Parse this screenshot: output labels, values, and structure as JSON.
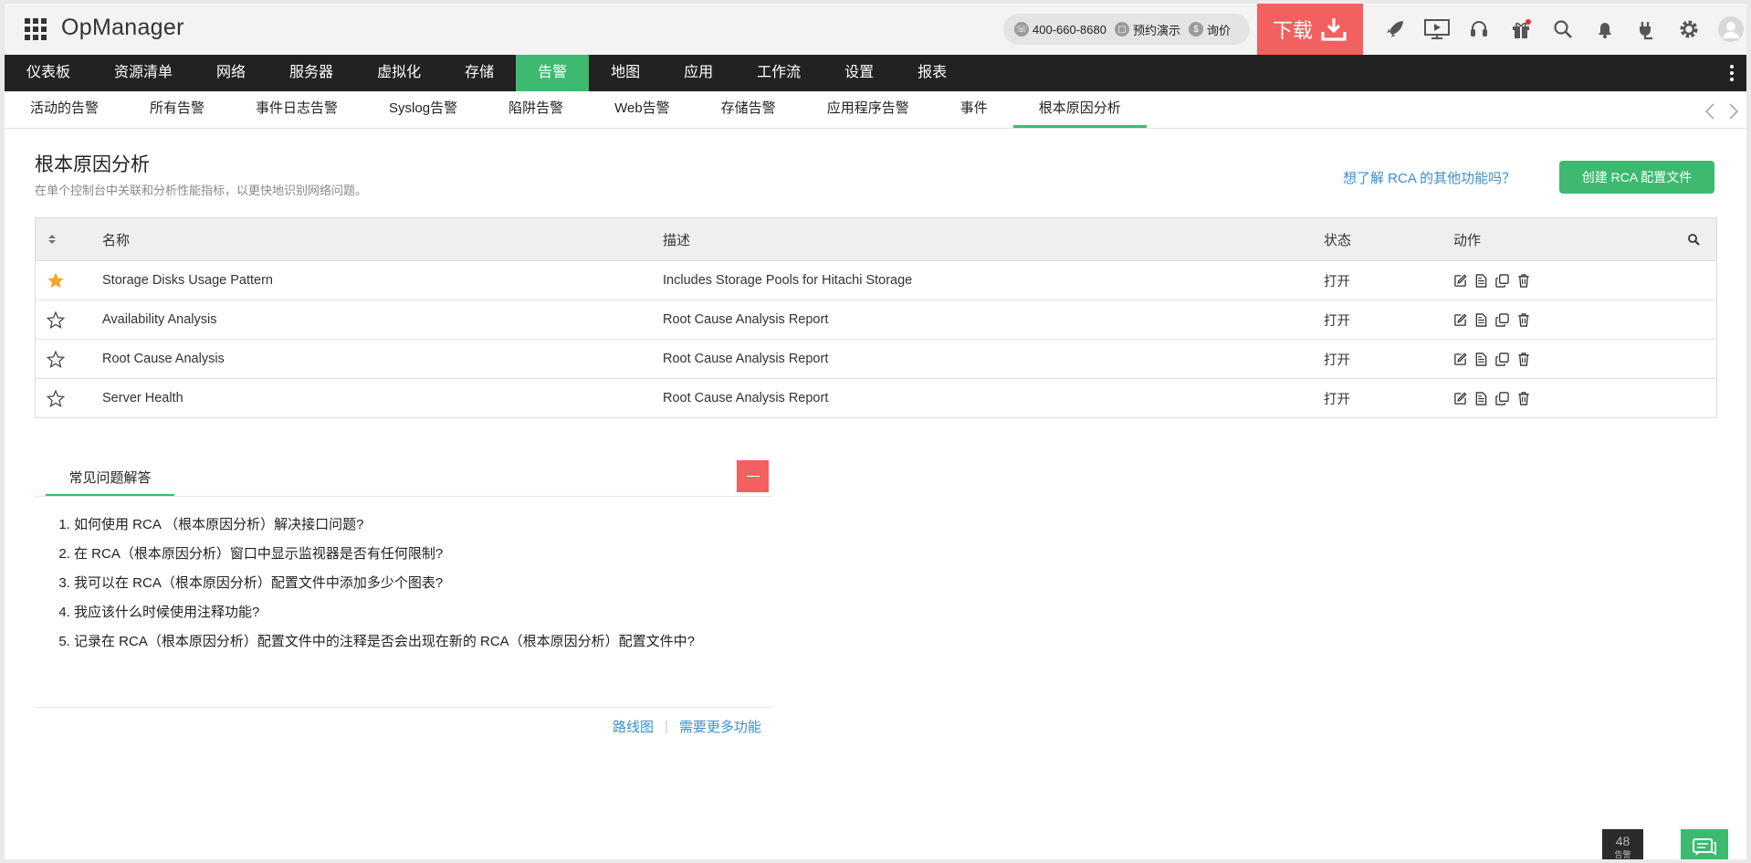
{
  "app": {
    "title": "OpManager"
  },
  "contact": {
    "phone": "400-660-8680",
    "demo": "预约演示",
    "price": "询价"
  },
  "download": {
    "label": "下载"
  },
  "main_nav": [
    "仪表板",
    "资源清单",
    "网络",
    "服务器",
    "虚拟化",
    "存储",
    "告警",
    "地图",
    "应用",
    "工作流",
    "设置",
    "报表"
  ],
  "main_nav_active": "告警",
  "sub_nav": [
    "活动的告警",
    "所有告警",
    "事件日志告警",
    "Syslog告警",
    "陷阱告警",
    "Web告警",
    "存储告警",
    "应用程序告警",
    "事件",
    "根本原因分析"
  ],
  "sub_nav_active": "根本原因分析",
  "page": {
    "title": "根本原因分析",
    "subtitle": "在单个控制台中关联和分析性能指标，以更快地识别网络问题。",
    "learn_more": "想了解 RCA 的其他功能吗？",
    "create_button": "创建 RCA 配置文件"
  },
  "table": {
    "headers": {
      "name": "名称",
      "desc": "描述",
      "status": "状态",
      "action": "动作"
    },
    "rows": [
      {
        "starred": true,
        "name": "Storage Disks Usage Pattern",
        "desc": "Includes Storage Pools for Hitachi Storage",
        "status": "打开"
      },
      {
        "starred": false,
        "name": "Availability Analysis",
        "desc": "Root Cause Analysis Report",
        "status": "打开"
      },
      {
        "starred": false,
        "name": "Root Cause Analysis",
        "desc": "Root Cause Analysis Report",
        "status": "打开"
      },
      {
        "starred": false,
        "name": "Server Health",
        "desc": "Root Cause Analysis Report",
        "status": "打开"
      }
    ]
  },
  "faq": {
    "tab": "常见问题解答",
    "items": [
      "如何使用 RCA （根本原因分析）解决接口问题?",
      "在 RCA（根本原因分析）窗口中显示监视器是否有任何限制?",
      "我可以在 RCA（根本原因分析）配置文件中添加多少个图表?",
      "我应该什么时候使用注释功能?",
      "记录在 RCA（根本原因分析）配置文件中的注释是否会出现在新的 RCA（根本原因分析）配置文件中?"
    ],
    "links": {
      "roadmap": "路线图",
      "more": "需要更多功能"
    }
  },
  "alarm_widget": {
    "count": "48",
    "label": "告警"
  },
  "colors": {
    "accent": "#3dba6f",
    "danger": "#f26060",
    "nav_bg": "#222222",
    "link": "#3a8fd1",
    "star": "#f5a623"
  },
  "icons": [
    "apps-grid-icon",
    "phone-icon",
    "demo-icon",
    "dollar-icon",
    "download-icon",
    "rocket-icon",
    "presentation-icon",
    "headset-icon",
    "gift-icon",
    "search-icon",
    "bell-icon",
    "plug-icon",
    "gear-icon",
    "user-avatar-icon",
    "edit-icon",
    "report-icon",
    "copy-icon",
    "trash-icon",
    "chat-icon"
  ]
}
